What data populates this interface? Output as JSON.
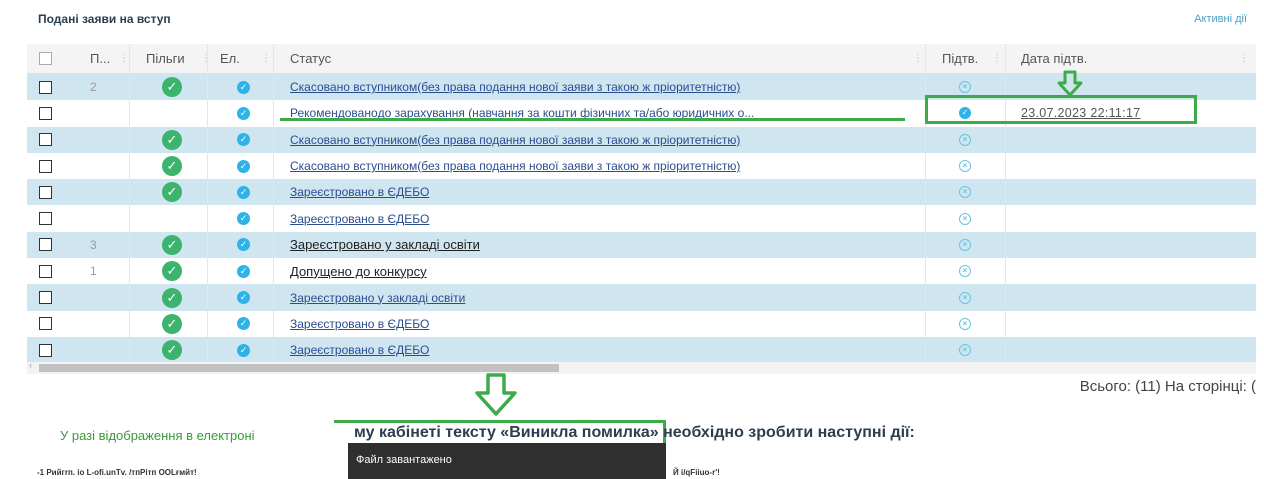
{
  "header": {
    "title": "Подані заяви на вступ",
    "active_link": "Активні дії"
  },
  "grid": {
    "columns": [
      "П...",
      "Пільги",
      "Ел.",
      "Статус",
      "Підтв.",
      "Дата підтв."
    ],
    "rows": [
      {
        "num": "2",
        "benefit": true,
        "electronic": true,
        "status_main": "Скасовано вступником",
        "status_extra": " (без права подання нової заяви з такою ж пріоритетністю)",
        "confirmed": false,
        "date": ""
      },
      {
        "num": "",
        "benefit": false,
        "electronic": true,
        "status_main": "Рекомендовано",
        "status_extra": " до зарахування (навчання за кошти фізичних та/або юридичних о...",
        "confirmed": true,
        "date": "23.07.2023 22:11:17"
      },
      {
        "num": "",
        "benefit": true,
        "electronic": true,
        "status_main": "Скасовано вступником",
        "status_extra": " (без права подання нової заяви з такою ж пріоритетністю)",
        "confirmed": false,
        "date": ""
      },
      {
        "num": "",
        "benefit": true,
        "electronic": true,
        "status_main": "Скасовано вступником",
        "status_extra": " (без права подання нової заяви з такою ж пріоритетністю)",
        "confirmed": false,
        "date": ""
      },
      {
        "num": "",
        "benefit": true,
        "electronic": true,
        "status_main": "Зареєстровано в ЄДЕБО",
        "status_extra": "",
        "confirmed": false,
        "date": ""
      },
      {
        "num": "",
        "benefit": false,
        "electronic": true,
        "status_main": "Зареєстровано в ЄДЕБО",
        "status_extra": "",
        "confirmed": false,
        "date": ""
      },
      {
        "num": "3",
        "benefit": true,
        "electronic": true,
        "status_main": "Зареєстровано у закладі освіти",
        "status_extra": "",
        "confirmed": false,
        "date": "",
        "dark": true
      },
      {
        "num": "1",
        "benefit": true,
        "electronic": true,
        "status_main": "Допущено до конкурсу",
        "status_extra": "",
        "confirmed": false,
        "date": "",
        "dark": true
      },
      {
        "num": "",
        "benefit": true,
        "electronic": true,
        "status_main": "Зареєстровано у закладі освіти",
        "status_extra": "",
        "confirmed": false,
        "date": ""
      },
      {
        "num": "",
        "benefit": true,
        "electronic": true,
        "status_main": "Зареєстровано в ЄДЕБО",
        "status_extra": "",
        "confirmed": false,
        "date": ""
      },
      {
        "num": "",
        "benefit": true,
        "electronic": true,
        "status_main": "Зареєстровано в ЄДЕБО",
        "status_extra": "",
        "confirmed": false,
        "date": ""
      }
    ]
  },
  "footer": {
    "total": "Всього: (11) На сторінці: (",
    "note": "У разі відображення в електроні",
    "error_text": "му кабінеті тексту «Виникла помилка» необхідно зробити наступні дії:",
    "toast": "Файл завантажено",
    "bottom_left": "-1 Рийгrп. іо L-ofi.unTv. /тпРітп OOLғмйт!",
    "bottom_right": "Й і/qFiiuo-r'!"
  },
  "colors": {
    "accent_green": "#3dab4a",
    "row_alt": "#cfe6f1",
    "link_blue": "#2a4d8f"
  }
}
